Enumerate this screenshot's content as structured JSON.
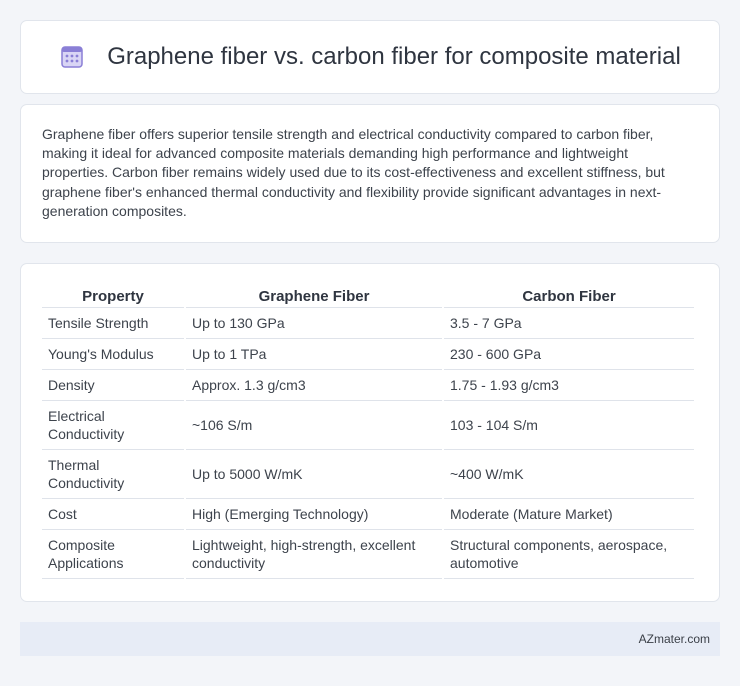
{
  "header": {
    "title": "Graphene fiber vs. carbon fiber for composite material",
    "icon": "calendar-grid-icon",
    "icon_color": "#8a7fd6"
  },
  "summary": {
    "text": "Graphene fiber offers superior tensile strength and electrical conductivity compared to carbon fiber, making it ideal for advanced composite materials demanding high performance and lightweight properties. Carbon fiber remains widely used due to its cost-effectiveness and excellent stiffness, but graphene fiber's enhanced thermal conductivity and flexibility provide significant advantages in next-generation composites."
  },
  "table": {
    "headers": [
      "Property",
      "Graphene Fiber",
      "Carbon Fiber"
    ],
    "rows": [
      [
        "Tensile Strength",
        "Up to 130 GPa",
        "3.5 - 7 GPa"
      ],
      [
        "Young's Modulus",
        "Up to 1 TPa",
        "230 - 600 GPa"
      ],
      [
        "Density",
        "Approx. 1.3 g/cm3",
        "1.75 - 1.93 g/cm3"
      ],
      [
        "Electrical Conductivity",
        "~106 S/m",
        "103 - 104 S/m"
      ],
      [
        "Thermal Conductivity",
        "Up to 5000 W/mK",
        "~400 W/mK"
      ],
      [
        "Cost",
        "High (Emerging Technology)",
        "Moderate (Mature Market)"
      ],
      [
        "Composite Applications",
        "Lightweight, high-strength, excellent conductivity",
        "Structural components, aerospace, automotive"
      ]
    ]
  },
  "footer": {
    "text": "AZmater.com"
  }
}
